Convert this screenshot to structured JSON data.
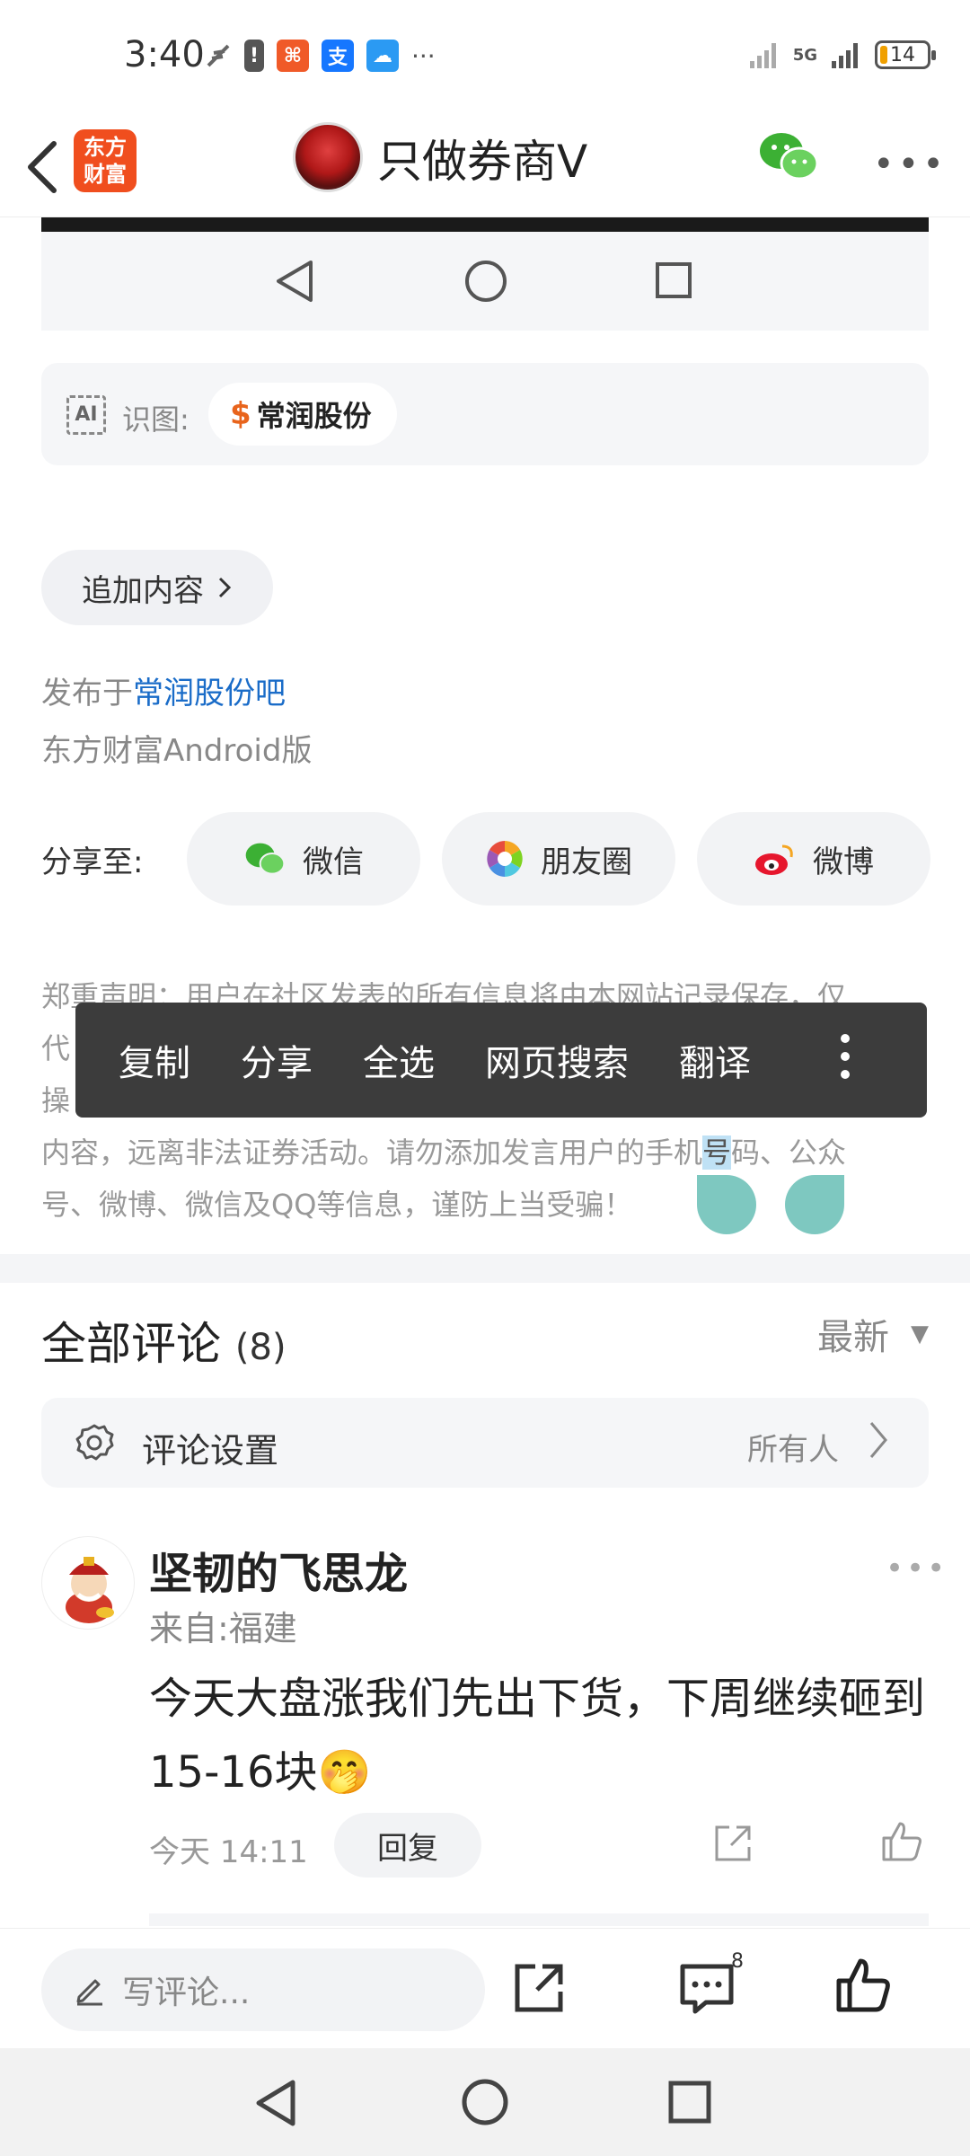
{
  "status_bar": {
    "time": "3:40",
    "battery": "14",
    "network": "5G"
  },
  "header": {
    "app_logo": "东方财富",
    "title": "只做券商V"
  },
  "recognition": {
    "label": "识图:",
    "ai_badge": "AI",
    "stock": "常润股份",
    "stock_symbol": "$"
  },
  "post": {
    "add_content": "追加内容",
    "published_prefix": "发布于",
    "published_bar": "常润股份吧",
    "client": "东方财富Android版"
  },
  "share": {
    "label": "分享至:",
    "wechat": "微信",
    "moments": "朋友圈",
    "weibo": "微博"
  },
  "disclaimer": {
    "line1": "郑重声明：用户在社区发表的所有信息将由本网站记录保存，仅",
    "line2_start": "代",
    "line3_start": "操",
    "line4_a": "内容，远离非法证券活动。请勿添加发言用户的手机",
    "line4_hl": "号",
    "line4_b": "码、公众",
    "line5": "号、微博、微信及QQ等信息，谨防上当受骗！"
  },
  "context_menu": {
    "copy": "复制",
    "share": "分享",
    "select_all": "全选",
    "web_search": "网页搜索",
    "translate": "翻译"
  },
  "comments": {
    "title": "全部评论",
    "count": "(8)",
    "sort": "最新",
    "settings_label": "评论设置",
    "settings_value": "所有人",
    "items": [
      {
        "name": "坚韧的飞思龙",
        "location": "来自:福建",
        "text": "今天大盘涨我们先出下货，下周继续砸到15-16块🤭",
        "time": "今天 14:11",
        "reply": "回复"
      }
    ]
  },
  "bottom_bar": {
    "write_placeholder": "写评论...",
    "comment_badge": "8"
  },
  "colors": {
    "brand": "#f04e1e",
    "link": "#1a6cc8",
    "context_menu_bg": "#3c3c3c",
    "selection_handle": "#7ec8c0",
    "wechat_green": "#3cb034",
    "weibo_red": "#e6162d"
  }
}
